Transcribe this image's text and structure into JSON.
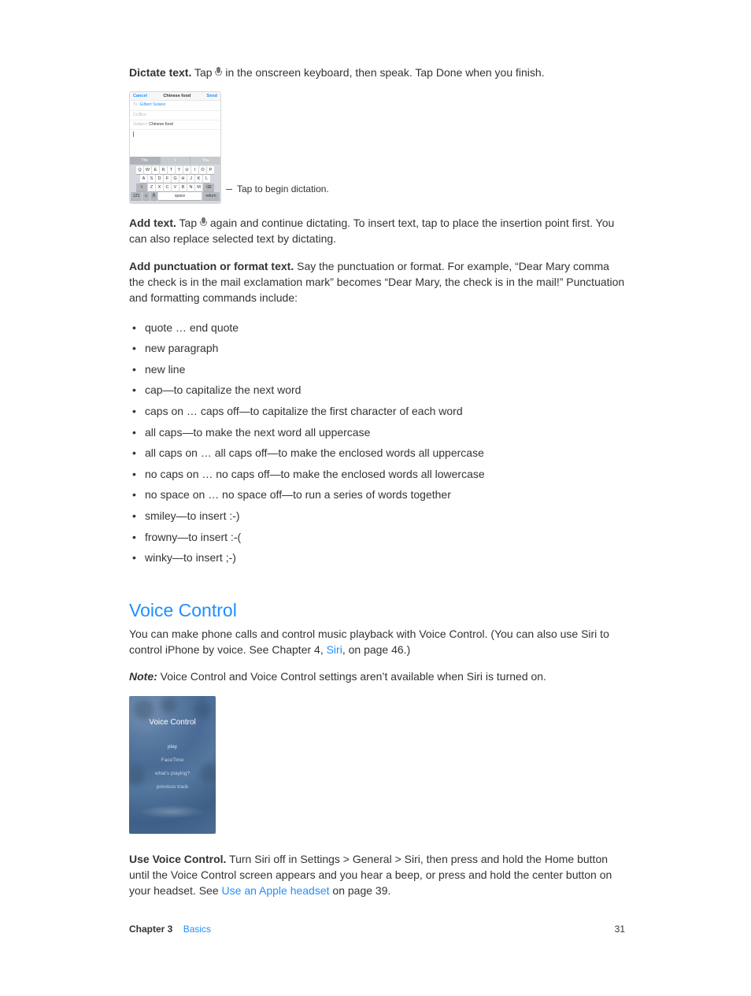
{
  "dictate": {
    "label": "Dictate text.",
    "pre": " Tap ",
    "post": " in the onscreen keyboard, then speak. Tap Done when you finish."
  },
  "iphone_compose": {
    "cancel": "Cancel",
    "title": "Chinese food",
    "send": "Send",
    "to_label": "To:",
    "to_value": "Gilbert Solano",
    "cc_label": "Cc/Bcc:",
    "subject_label": "Subject:",
    "subject_value": "Chinese food",
    "suggestions": [
      "The",
      "I",
      "You"
    ],
    "row1": [
      "Q",
      "W",
      "E",
      "R",
      "T",
      "Y",
      "U",
      "I",
      "O",
      "P"
    ],
    "row2": [
      "A",
      "S",
      "D",
      "F",
      "G",
      "H",
      "J",
      "K",
      "L"
    ],
    "row3": [
      "Z",
      "X",
      "C",
      "V",
      "B",
      "N",
      "M"
    ],
    "shift": "⇧",
    "backspace": "⌫",
    "numkey": "123",
    "emoji": "☺",
    "mic": "🎤",
    "space": "space",
    "return": "return"
  },
  "callout": "Tap to begin dictation.",
  "addtext": {
    "label": "Add text.",
    "pre": " Tap ",
    "post": " again and continue dictating. To insert text, tap to place the insertion point first. You can also replace selected text by dictating."
  },
  "punct": {
    "label": "Add punctuation or format text.",
    "body": " Say the punctuation or format. For example, “Dear Mary comma the check is in the mail exclamation mark” becomes “Dear Mary, the check is in the mail!” Punctuation and formatting commands include:"
  },
  "commands": [
    "quote … end quote",
    "new paragraph",
    "new line",
    "cap—to capitalize the next word",
    "caps on … caps off—to capitalize the first character of each word",
    "all caps—to make the next word all uppercase",
    "all caps on … all caps off—to make the enclosed words all uppercase",
    "no caps on … no caps off—to make the enclosed words all lowercase",
    "no space on … no space off—to run a series of words together",
    "smiley—to insert :-)",
    "frowny—to insert :-(",
    "winky—to insert ;-)"
  ],
  "voice_control": {
    "heading": "Voice Control",
    "intro_pre": "You can make phone calls and control music playback with Voice Control. (You can also use Siri to control iPhone by voice. See Chapter 4, ",
    "intro_link": "Siri",
    "intro_post": ", on page 46.)",
    "note_label": "Note:",
    "note_body": "  Voice Control and Voice Control settings aren’t available when Siri is turned on.",
    "screenshot": {
      "title": "Voice Control",
      "items": [
        "play",
        "FaceTime",
        "what's playing?",
        "previous track"
      ]
    },
    "use": {
      "label": "Use Voice Control.",
      "body_pre": " Turn Siri off in Settings > General > Siri, then press and hold the Home button until the Voice Control screen appears and you hear a beep, or press and hold the center button on your headset. See ",
      "link": "Use an Apple headset",
      "body_post": " on page 39."
    }
  },
  "footer": {
    "chapter_label": "Chapter  3",
    "chapter_name": "Basics",
    "page_number": "31"
  }
}
